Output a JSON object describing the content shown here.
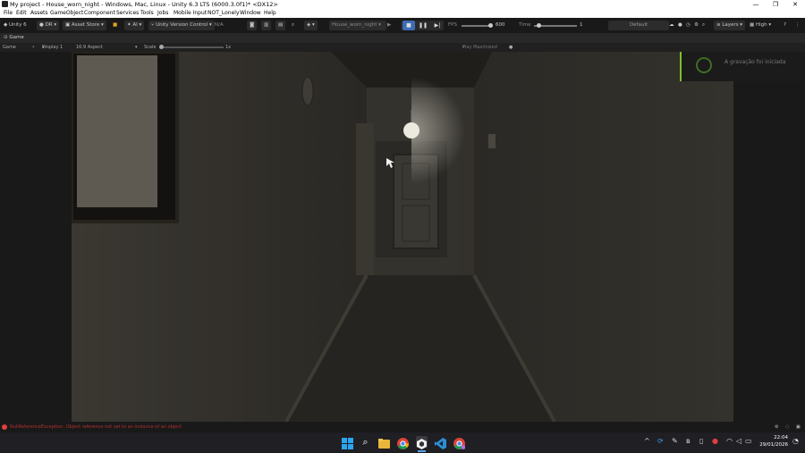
{
  "window": {
    "title": "My project - House_worn_night - Windows, Mac, Linux - Unity 6.3 LTS (6000.3.0f1)* <DX12>",
    "controls": [
      "—",
      "❐",
      "✕"
    ]
  },
  "menu": [
    "File",
    "Edit",
    "Assets",
    "GameObject",
    "Component",
    "Services",
    "Tools",
    "Jobs",
    "Mobile Input",
    "NOT_Lonely",
    "Window",
    "Help"
  ],
  "toolbar": {
    "unity_label": "Unity 6",
    "account_label": "DR",
    "asset_store_label": "Asset Store",
    "ai_label": "AI",
    "vcs_label": "Unity Version Control",
    "vcs_status": "N/A",
    "scene_dropdown": "House_worn_night",
    "fps_label": "FPS",
    "fps_value": "600",
    "time_label": "Time",
    "time_value": "1",
    "layout_label": "Default",
    "layers_label": "Layers",
    "quality_label": "High"
  },
  "game_tab": {
    "tab_label": "Game",
    "view_dropdown": "Game",
    "display_dropdown": "Display 1",
    "aspect_dropdown": "16:9 Aspect",
    "scale_label": "Scale",
    "scale_value": "1x",
    "play_mode_dropdown": "Play Maximized"
  },
  "notification": {
    "text": "A gravação foi iniciada",
    "accent_color": "#7bbf2a"
  },
  "status": {
    "error_message": "NullReferenceException: Object reference not set to an instance of an object",
    "error_color": "#e04040"
  },
  "taskbar": {
    "apps": [
      "windows-start-icon",
      "search-icon",
      "file-explorer-icon",
      "chrome-icon",
      "unity-icon",
      "vscode-icon",
      "chrome-profile-icon"
    ],
    "time": "22:04",
    "date": "29/01/2026"
  }
}
